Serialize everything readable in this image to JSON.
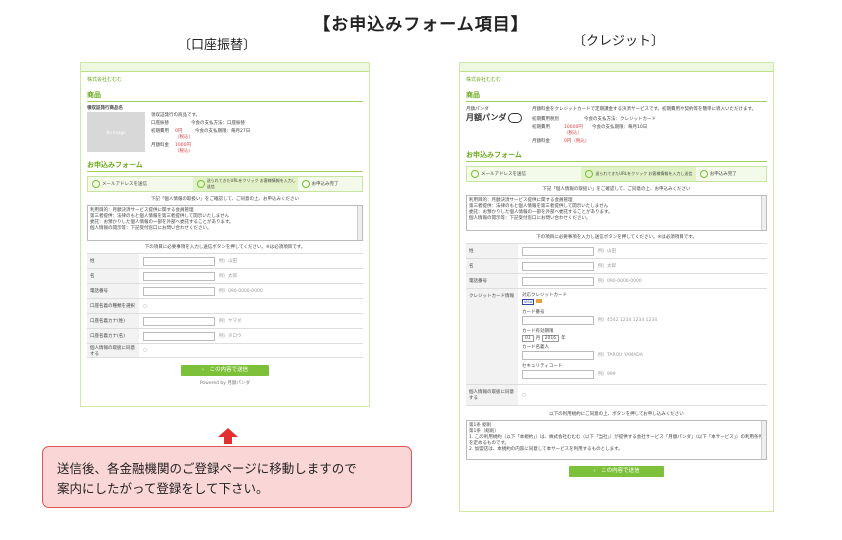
{
  "page_title": "【お申込みフォーム項目】",
  "caption_left": "〔口座振替〕",
  "caption_right": "〔クレジット〕",
  "left": {
    "shop": "株式会社むむむ",
    "product_section": "商品",
    "product_name": "領収証発行商品名",
    "thumb": "No Image",
    "product_desc": "領収証発行の商品です。",
    "label_plan": "口座振替",
    "label_fee": "初期費用",
    "fee": "0円（税込）",
    "monthly_label": "月額料金",
    "monthly": "1000円（税込）",
    "pay_method": "今会の支払方法：口座振替",
    "pay_date": "今会の支払期限：毎月27日",
    "form_section": "お申込みフォーム",
    "steps": [
      "メールアドレスを送信",
      "送られてきたURLをクリック お客様情報を入力し送信",
      "お申込み完了"
    ],
    "notice": "下記「個人情報の取扱い」をご確認して、ご同意の上、お申込みください",
    "terms": "利用目的：月額決済サービス提供に関する会員管理\n第三者提供：法律のもと個人情報を第三者提供して開示いたしません\n委託：お預かりした個人情報の一部を外部へ委託することがあります。\n個人情報の開示等：下記受付窓口にお問い合わせください。",
    "agree_line": "下の項目に必要事項を入力し送信ボタンを押してください。※は必須項目です。",
    "fields": [
      {
        "label": "姓",
        "hint": "例）山田"
      },
      {
        "label": "名",
        "hint": "例）太郎"
      },
      {
        "label": "電話番号",
        "hint": "例）090-0000-0000"
      },
      {
        "label": "口座名義の種類を選択",
        "hint": "○"
      },
      {
        "label": "口座名義カナ(姓)",
        "hint": "例）ヤマダ"
      },
      {
        "label": "口座名義カナ(名)",
        "hint": "例）タロウ"
      },
      {
        "label": "個人情報の取扱に同意する",
        "hint": "○"
      }
    ],
    "submit": "›　この内容で送信",
    "powered": "Powered by 月額パンダ"
  },
  "right": {
    "shop": "株式会社むむむ",
    "product_section": "商品",
    "brand_small": "月額パンダ",
    "brand": "月額パンダ",
    "product_desc": "月額料金をクレジットカードで定期課金する決済サービスです。初期費用や契約等を簡単に導入いただけます。",
    "label_fee": "初期費用税別",
    "fee": "10000円（税込）",
    "label_fee2": "初期費用",
    "fee2": "0円（税込）",
    "monthly_label": "月額料金",
    "monthly": "0円（税込）",
    "pay_method": "今会の支払方法：クレジットカード",
    "pay_date": "今会の支払期限：毎月10日",
    "form_section": "お申込みフォーム",
    "steps": [
      "メールアドレスを送信",
      "送られてきたURLをクリック お客様情報を入力し送信",
      "お申込み完了"
    ],
    "notice": "下記「個人情報の取扱い」をご確認して、ご同意の上、お申込みください",
    "terms": "利用目的：月額決済サービス提供に関する会員管理\n第三者提供：法律のもと個人情報を第三者提供して開示いたしません\n委託：お預かりした個人情報の一部を外部へ委託することがあります。\n個人情報の開示等：下記受付窓口にお問い合わせください。",
    "agree_line": "下の項目に必要事項を入力し送信ボタンを押してください。※は必須項目です。",
    "fields": [
      {
        "label": "姓",
        "hint": "例）山田"
      },
      {
        "label": "名",
        "hint": "例）太郎"
      },
      {
        "label": "電話番号",
        "hint": "例）090-0000-0000"
      }
    ],
    "card_label": "クレジットカード情報",
    "card_types": "対応クレジットカード",
    "card_badge": "VISA",
    "card_number_label": "カード番号",
    "card_number_hint": "例）4542 1234 1234 1234",
    "expiry_label": "カード有効期限",
    "expiry_month": "01",
    "expiry_month_unit": "月",
    "expiry_year": "2016",
    "expiry_year_unit": "年",
    "holder_label": "カード名義人",
    "holder_hint": "例）TAROU YAMADA",
    "cvv_label": "セキュリティコード",
    "cvv_hint": "例）999",
    "agree_field": "個人情報の取扱に同意する",
    "agree_field_hint": "○",
    "terms_notice": "以下の利用規約にご同意の上、ボタンを押してお申し込みください",
    "terms2": "第1条 総則\n第1条（総則）\n1. この利用規約（以下「本規約」）は、株式会社むむむ（以下「当社」）が提供する会社サービス「月額パンダ」（以下「本サービス」）の利用条件を定めるものです。\n2. 加盟店は、本規約の内容に同意して本サービスを利用するものとします。",
    "submit": "›　この内容で送信"
  },
  "callout": {
    "line1": "送信後、各金融機関のご登録ページに移動しますので",
    "line2": "案内にしたがって登録をして下さい。"
  },
  "colors": {
    "accent": "#7dc13a",
    "callout_bg": "#fbd6d6",
    "callout_border": "#e05555",
    "arrow": "#e03030"
  }
}
